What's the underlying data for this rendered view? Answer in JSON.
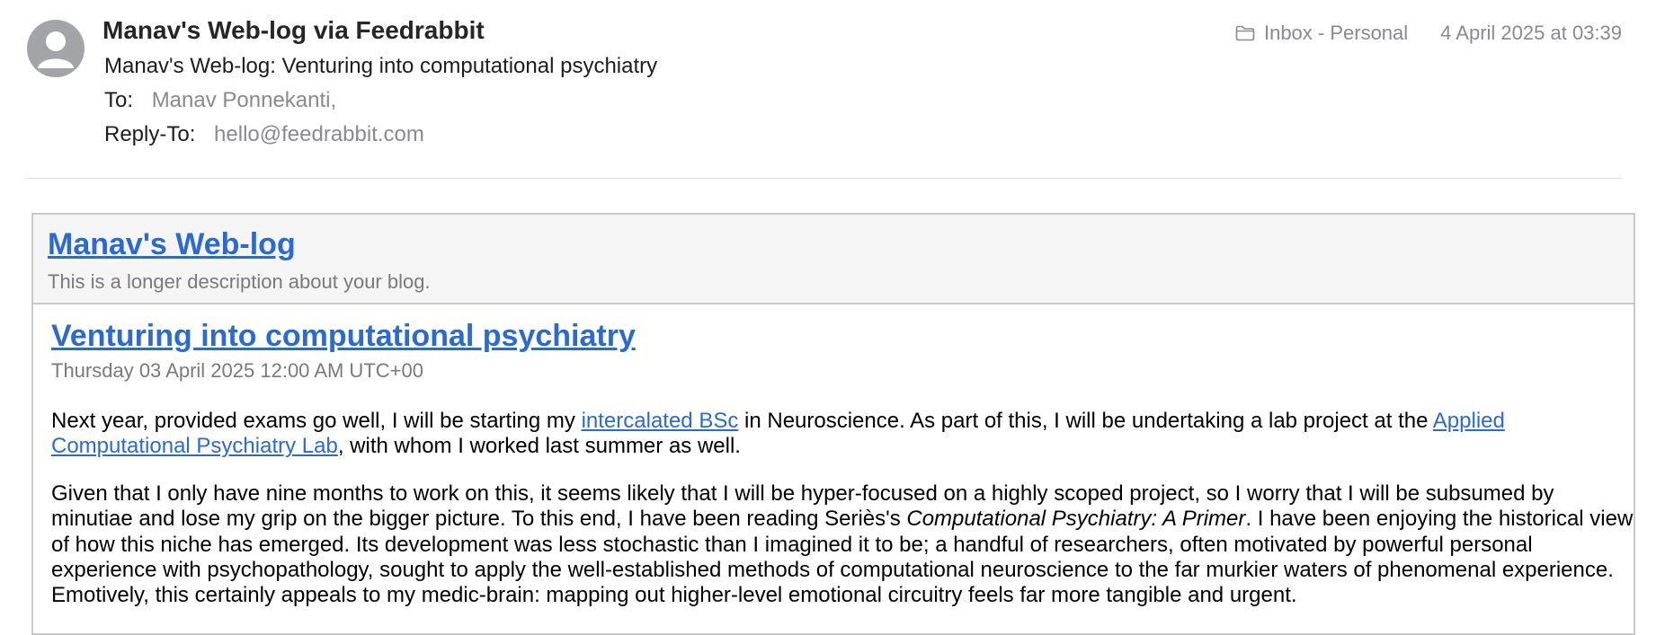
{
  "email": {
    "sender": "Manav's Web-log via Feedrabbit",
    "subject": "Manav's Web-log: Venturing into computational psychiatry",
    "to_label": "To:",
    "to_value": "Manav Ponnekanti,",
    "reply_to_label": "Reply-To:",
    "reply_to_value": "hello@feedrabbit.com",
    "mailbox": "Inbox - Personal",
    "date": "4 April 2025 at 03:39",
    "icons": {
      "avatar": "person-avatar-icon",
      "mailbox": "folder-icon"
    }
  },
  "blog": {
    "title": "Manav's Web-log",
    "description": "This is a longer description about your blog."
  },
  "post": {
    "title": "Venturing into computational psychiatry",
    "date": "Thursday 03 April 2025 12:00 AM UTC+00",
    "p1": {
      "t1": "Next year, provided exams go well, I will be starting my ",
      "link1": "intercalated BSc",
      "t2": " in Neuroscience. As part of this, I will be undertaking a lab project at the ",
      "link2": "Applied Computational Psychiatry Lab",
      "t3": ", with whom I worked last summer as well."
    },
    "p2": {
      "t1": "Given that I only have nine months to work on this, it seems likely that I will be hyper-focused on a highly scoped project, so I worry that I will be subsumed by minutiae and lose my grip on the bigger picture. To this end, I have been reading Seriès's ",
      "book": "Computational Psychiatry: A Primer",
      "t2": ". I have been enjoying the historical view of how this niche has emerged. Its development was less stochastic than I imagined it to be; a handful of researchers, often motivated by powerful personal experience with psychopathology, sought to apply the well-established methods of computational neuroscience to the far murkier waters of phenomenal experience. Emotively, this certainly appeals to my medic-brain: mapping out higher-level emotional circuitry feels far more tangible and urgent."
    }
  },
  "colors": {
    "link": "#2a6ad1",
    "muted": "#8a8a8e",
    "avatar": "#a3a4a8",
    "blog_header_bg": "#f5f5f5",
    "border": "#c9c9c9"
  }
}
